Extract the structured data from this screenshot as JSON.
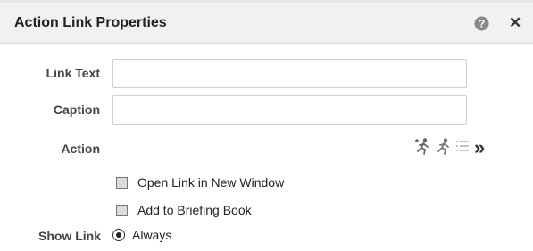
{
  "dialog": {
    "title": "Action Link Properties",
    "help_icon": "help-circle-icon",
    "close_label": "✕"
  },
  "form": {
    "link_text": {
      "label": "Link Text",
      "value": ""
    },
    "caption": {
      "label": "Caption",
      "value": ""
    },
    "action": {
      "label": "Action",
      "tools": [
        "new-navigate-action-icon",
        "select-existing-action-icon",
        "action-list-icon",
        "more-icon"
      ],
      "more_glyph": "»"
    },
    "open_new_window": {
      "label": "Open Link in New Window",
      "checked": false
    },
    "add_briefing_book": {
      "label": "Add to Briefing Book",
      "checked": false
    },
    "show_link": {
      "label": "Show Link",
      "selected_option": "Always"
    }
  },
  "colors": {
    "titlebar_bg": "#f1f1f1",
    "input_border": "#cfcfcf",
    "checkbox_fill": "#dcdcdc"
  }
}
